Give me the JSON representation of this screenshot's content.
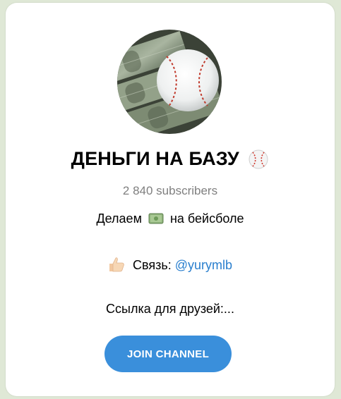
{
  "channel": {
    "title": "ДЕНЬГИ НА БАЗУ",
    "title_emoji": "baseball-icon",
    "subscribers": "2 840 subscribers",
    "description": {
      "before": "Делаем",
      "icon": "money-banknote-icon",
      "after": "на бейсболе"
    },
    "contact": {
      "icon": "thumbs-up-icon",
      "label": "Связь:",
      "handle": "@yurymlb"
    },
    "friends_text": "Ссылка для друзей:..."
  },
  "actions": {
    "join_label": "JOIN CHANNEL"
  },
  "colors": {
    "accent": "#3a8fdb",
    "link": "#2a7fce",
    "muted": "#7f7f7f"
  }
}
